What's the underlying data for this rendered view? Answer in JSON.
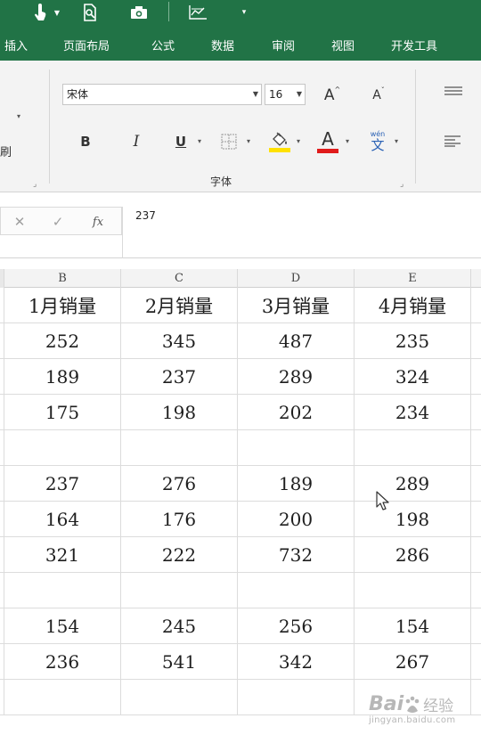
{
  "qat": {
    "icons": [
      "touch-mode-icon",
      "dropdown-arrow-icon",
      "print-preview-icon",
      "camera-icon",
      "chart-icon",
      "customize-qat-icon"
    ]
  },
  "tabs": [
    "插入",
    "页面布局",
    "公式",
    "数据",
    "审阅",
    "视图",
    "开发工具"
  ],
  "ribbon": {
    "brush_label": "刷",
    "font_name": "宋体",
    "font_size": "16",
    "bold": "B",
    "italic": "I",
    "underline": "U",
    "font_color_glyph": "A",
    "increase_font": "A",
    "decrease_font": "A",
    "phonetic_top": "wén",
    "phonetic_glyph": "文",
    "group_label": "字体",
    "colors": {
      "fill_highlight": "#ffe100",
      "font_color": "#e01b1b",
      "accent": "#217346"
    }
  },
  "formula_bar": {
    "fx_label": "fx",
    "content": "237"
  },
  "grid": {
    "columns": [
      "B",
      "C",
      "D",
      "E"
    ],
    "header_row": [
      "1月销量",
      "2月销量",
      "3月销量",
      "4月销量"
    ],
    "rows": [
      [
        "252",
        "345",
        "487",
        "235"
      ],
      [
        "189",
        "237",
        "289",
        "324"
      ],
      [
        "175",
        "198",
        "202",
        "234"
      ],
      [
        "",
        "",
        "",
        ""
      ],
      [
        "237",
        "276",
        "189",
        "289"
      ],
      [
        "164",
        "176",
        "200",
        "198"
      ],
      [
        "321",
        "222",
        "732",
        "286"
      ],
      [
        "",
        "",
        "",
        ""
      ],
      [
        "154",
        "245",
        "256",
        "154"
      ],
      [
        "236",
        "541",
        "342",
        "267"
      ],
      [
        "",
        "",
        "",
        ""
      ]
    ]
  },
  "watermark": {
    "brand": "Bai",
    "brand2": "经验",
    "url": "jingyan.baidu.com"
  }
}
